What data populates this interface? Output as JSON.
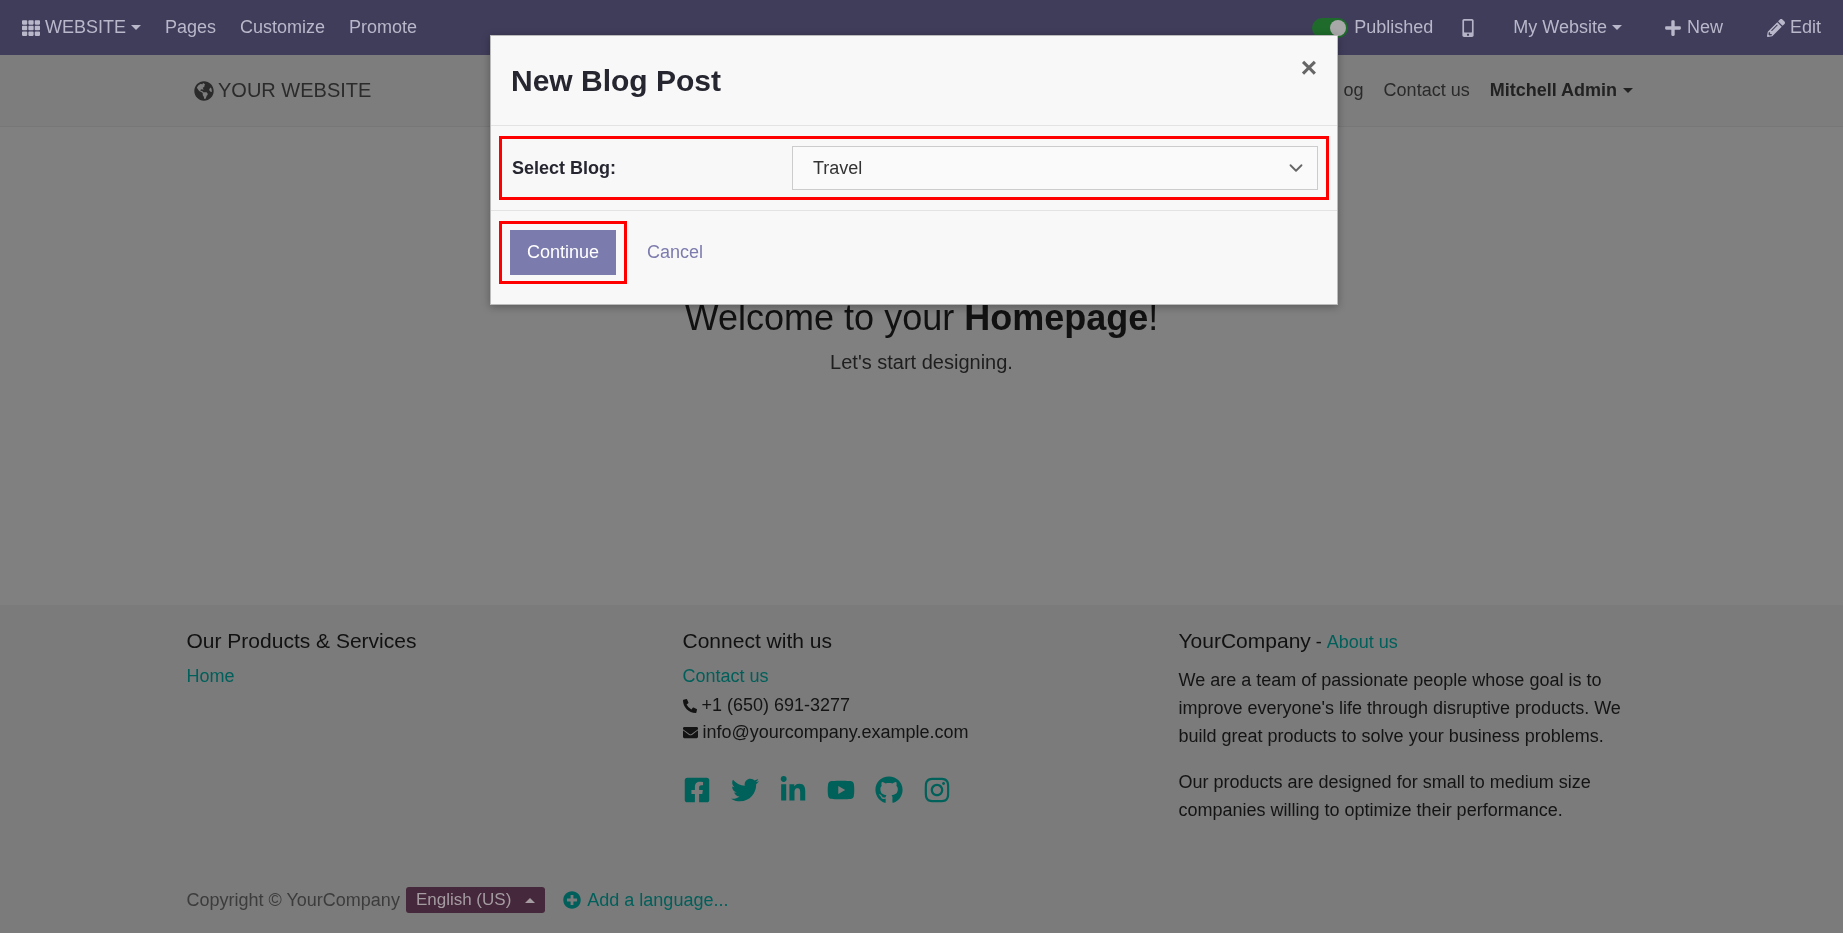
{
  "admin_bar": {
    "app_menu": "WEBSITE",
    "menu": [
      "Pages",
      "Customize",
      "Promote"
    ],
    "published": {
      "label": "Published",
      "on": true
    },
    "website_menu": "My Website",
    "new": "New",
    "edit": "Edit"
  },
  "header": {
    "logo": "YOUR WEBSITE",
    "nav": [
      "og",
      "Contact us"
    ],
    "user": "Mitchell Admin"
  },
  "hero": {
    "title": "Welcome to your **Homepage**!",
    "subtitle": "Let's start designing."
  },
  "modal": {
    "title": "New Blog Post",
    "close": "×",
    "field_label": "Select Blog:",
    "select_value": "Travel",
    "continue": "Continue",
    "cancel": "Cancel"
  },
  "footer": {
    "columns": [
      {
        "heading": "Our Products & Services",
        "links": [
          "Home"
        ]
      },
      {
        "heading": "Connect with us",
        "links": [
          "Contact us"
        ],
        "phone": "+1 (650) 691-3277",
        "email": "info@yourcompany.example.com",
        "social": [
          {
            "kind": "facebook"
          },
          {
            "kind": "twitter"
          },
          {
            "kind": "linkedin"
          },
          {
            "kind": "youtube"
          },
          {
            "kind": "github"
          },
          {
            "kind": "instagram"
          }
        ]
      },
      {
        "heading": "YourCompany",
        "heading_separator": "-",
        "heading_link": "About us",
        "paragraphs": [
          "We are a team of passionate people whose goal is to improve everyone's life through disruptive products. We build great products to solve your business problems.",
          "Our products are designed for small to medium size companies willing to optimize their performance."
        ]
      }
    ]
  },
  "bottom": {
    "copyright": "Copyright © YourCompany",
    "language": "English (US)",
    "add_language": "Add a language..."
  }
}
